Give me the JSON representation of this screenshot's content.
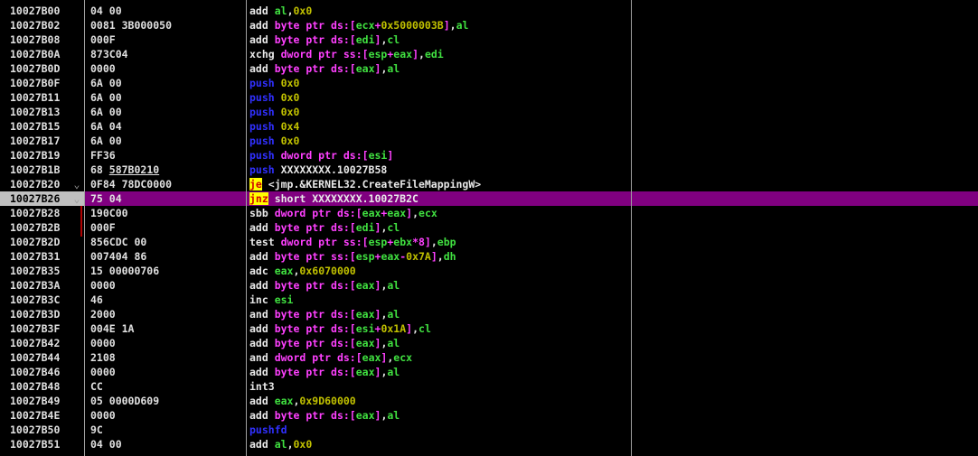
{
  "colors": {
    "background": "#000000",
    "selected_row": "#800080",
    "selected_address_bg": "#c0c0c0",
    "push_pop": "#3030ff",
    "keyword": "#ff40ff",
    "register": "#40e040",
    "immediate": "#c0c000",
    "jump_highlight_bg": "#ffff00",
    "jump_highlight_fg": "#d00000"
  },
  "rows": [
    {
      "addr": "10027B00",
      "mark": "",
      "hex": "04 00",
      "t": [
        [
          "mn",
          "add "
        ],
        [
          "gr",
          "al"
        ],
        [
          "tx",
          ","
        ],
        [
          "nu",
          "0x0"
        ]
      ]
    },
    {
      "addr": "10027B02",
      "mark": "",
      "hex": "0081 3B000050",
      "t": [
        [
          "mn",
          "add "
        ],
        [
          "kw",
          "byte ptr ds:["
        ],
        [
          "gr",
          "ecx"
        ],
        [
          "kw",
          "+"
        ],
        [
          "nu",
          "0x5000003B"
        ],
        [
          "kw",
          "]"
        ],
        [
          "tx",
          ","
        ],
        [
          "gr",
          "al"
        ]
      ]
    },
    {
      "addr": "10027B08",
      "mark": "",
      "hex": "000F",
      "t": [
        [
          "mn",
          "add "
        ],
        [
          "kw",
          "byte ptr ds:["
        ],
        [
          "gr",
          "edi"
        ],
        [
          "kw",
          "]"
        ],
        [
          "tx",
          ","
        ],
        [
          "gr",
          "cl"
        ]
      ]
    },
    {
      "addr": "10027B0A",
      "mark": "",
      "hex": "873C04",
      "t": [
        [
          "mn",
          "xchg "
        ],
        [
          "kw",
          "dword ptr ss:["
        ],
        [
          "gr",
          "esp"
        ],
        [
          "kw",
          "+"
        ],
        [
          "gr",
          "eax"
        ],
        [
          "kw",
          "]"
        ],
        [
          "tx",
          ","
        ],
        [
          "gr",
          "edi"
        ]
      ]
    },
    {
      "addr": "10027B0D",
      "mark": "",
      "hex": "0000",
      "t": [
        [
          "mn",
          "add "
        ],
        [
          "kw",
          "byte ptr ds:["
        ],
        [
          "gr",
          "eax"
        ],
        [
          "kw",
          "]"
        ],
        [
          "tx",
          ","
        ],
        [
          "gr",
          "al"
        ]
      ]
    },
    {
      "addr": "10027B0F",
      "mark": "",
      "hex": "6A 00",
      "t": [
        [
          "pu",
          "push "
        ],
        [
          "nu",
          "0x0"
        ]
      ]
    },
    {
      "addr": "10027B11",
      "mark": "",
      "hex": "6A 00",
      "t": [
        [
          "pu",
          "push "
        ],
        [
          "nu",
          "0x0"
        ]
      ]
    },
    {
      "addr": "10027B13",
      "mark": "",
      "hex": "6A 00",
      "t": [
        [
          "pu",
          "push "
        ],
        [
          "nu",
          "0x0"
        ]
      ]
    },
    {
      "addr": "10027B15",
      "mark": "",
      "hex": "6A 04",
      "t": [
        [
          "pu",
          "push "
        ],
        [
          "nu",
          "0x4"
        ]
      ]
    },
    {
      "addr": "10027B17",
      "mark": "",
      "hex": "6A 00",
      "t": [
        [
          "pu",
          "push "
        ],
        [
          "nu",
          "0x0"
        ]
      ]
    },
    {
      "addr": "10027B19",
      "mark": "",
      "hex": "FF36",
      "t": [
        [
          "pu",
          "push "
        ],
        [
          "kw",
          "dword ptr ds:["
        ],
        [
          "gr",
          "esi"
        ],
        [
          "kw",
          "]"
        ]
      ]
    },
    {
      "addr": "10027B1B",
      "mark": "",
      "hex": "68 ",
      "hexu": "587B0210",
      "t": [
        [
          "pu",
          "push "
        ],
        [
          "tx",
          "XXXXXXXX.10027B58"
        ]
      ]
    },
    {
      "addr": "10027B20",
      "mark": "⌄",
      "hex": "0F84 78DC0000",
      "t": [
        [
          "hl",
          "je"
        ],
        [
          "tx",
          " <jmp.&KERNEL32.CreateFileMappingW>"
        ]
      ]
    },
    {
      "addr": "10027B26",
      "mark": "⌄",
      "hex": "75 04",
      "sel": true,
      "t": [
        [
          "hl",
          "jnz"
        ],
        [
          "tx",
          " short XXXXXXXX.10027B2C"
        ]
      ]
    },
    {
      "addr": "10027B28",
      "mark": "",
      "hex": "190C00",
      "t": [
        [
          "mn",
          "sbb "
        ],
        [
          "kw",
          "dword ptr ds:["
        ],
        [
          "gr",
          "eax"
        ],
        [
          "kw",
          "+"
        ],
        [
          "gr",
          "eax"
        ],
        [
          "kw",
          "]"
        ],
        [
          "tx",
          ","
        ],
        [
          "gr",
          "ecx"
        ]
      ]
    },
    {
      "addr": "10027B2B",
      "mark": "",
      "hex": "000F",
      "t": [
        [
          "mn",
          "add "
        ],
        [
          "kw",
          "byte ptr ds:["
        ],
        [
          "gr",
          "edi"
        ],
        [
          "kw",
          "]"
        ],
        [
          "tx",
          ","
        ],
        [
          "gr",
          "cl"
        ]
      ]
    },
    {
      "addr": "10027B2D",
      "mark": "",
      "hex": "856CDC 00",
      "t": [
        [
          "mn",
          "test "
        ],
        [
          "kw",
          "dword ptr ss:["
        ],
        [
          "gr",
          "esp"
        ],
        [
          "kw",
          "+"
        ],
        [
          "gr",
          "ebx"
        ],
        [
          "kw",
          "*8]"
        ],
        [
          "tx",
          ","
        ],
        [
          "gr",
          "ebp"
        ]
      ]
    },
    {
      "addr": "10027B31",
      "mark": "",
      "hex": "007404 86",
      "t": [
        [
          "mn",
          "add "
        ],
        [
          "kw",
          "byte ptr ss:["
        ],
        [
          "gr",
          "esp"
        ],
        [
          "kw",
          "+"
        ],
        [
          "gr",
          "eax"
        ],
        [
          "kw",
          "-"
        ],
        [
          "nu",
          "0x7A"
        ],
        [
          "kw",
          "]"
        ],
        [
          "tx",
          ","
        ],
        [
          "gr",
          "dh"
        ]
      ]
    },
    {
      "addr": "10027B35",
      "mark": "",
      "hex": "15 00000706",
      "t": [
        [
          "mn",
          "adc "
        ],
        [
          "gr",
          "eax"
        ],
        [
          "tx",
          ","
        ],
        [
          "nu",
          "0x6070000"
        ]
      ]
    },
    {
      "addr": "10027B3A",
      "mark": "",
      "hex": "0000",
      "t": [
        [
          "mn",
          "add "
        ],
        [
          "kw",
          "byte ptr ds:["
        ],
        [
          "gr",
          "eax"
        ],
        [
          "kw",
          "]"
        ],
        [
          "tx",
          ","
        ],
        [
          "gr",
          "al"
        ]
      ]
    },
    {
      "addr": "10027B3C",
      "mark": "",
      "hex": "46",
      "t": [
        [
          "mn",
          "inc "
        ],
        [
          "gr",
          "esi"
        ]
      ]
    },
    {
      "addr": "10027B3D",
      "mark": "",
      "hex": "2000",
      "t": [
        [
          "mn",
          "and "
        ],
        [
          "kw",
          "byte ptr ds:["
        ],
        [
          "gr",
          "eax"
        ],
        [
          "kw",
          "]"
        ],
        [
          "tx",
          ","
        ],
        [
          "gr",
          "al"
        ]
      ]
    },
    {
      "addr": "10027B3F",
      "mark": "",
      "hex": "004E 1A",
      "t": [
        [
          "mn",
          "add "
        ],
        [
          "kw",
          "byte ptr ds:["
        ],
        [
          "gr",
          "esi"
        ],
        [
          "kw",
          "+"
        ],
        [
          "nu",
          "0x1A"
        ],
        [
          "kw",
          "]"
        ],
        [
          "tx",
          ","
        ],
        [
          "gr",
          "cl"
        ]
      ]
    },
    {
      "addr": "10027B42",
      "mark": "",
      "hex": "0000",
      "t": [
        [
          "mn",
          "add "
        ],
        [
          "kw",
          "byte ptr ds:["
        ],
        [
          "gr",
          "eax"
        ],
        [
          "kw",
          "]"
        ],
        [
          "tx",
          ","
        ],
        [
          "gr",
          "al"
        ]
      ]
    },
    {
      "addr": "10027B44",
      "mark": "",
      "hex": "2108",
      "t": [
        [
          "mn",
          "and "
        ],
        [
          "kw",
          "dword ptr ds:["
        ],
        [
          "gr",
          "eax"
        ],
        [
          "kw",
          "]"
        ],
        [
          "tx",
          ","
        ],
        [
          "gr",
          "ecx"
        ]
      ]
    },
    {
      "addr": "10027B46",
      "mark": "",
      "hex": "0000",
      "t": [
        [
          "mn",
          "add "
        ],
        [
          "kw",
          "byte ptr ds:["
        ],
        [
          "gr",
          "eax"
        ],
        [
          "kw",
          "]"
        ],
        [
          "tx",
          ","
        ],
        [
          "gr",
          "al"
        ]
      ]
    },
    {
      "addr": "10027B48",
      "mark": "",
      "hex": "CC",
      "t": [
        [
          "mn",
          "int3"
        ]
      ]
    },
    {
      "addr": "10027B49",
      "mark": "",
      "hex": "05 0000D609",
      "t": [
        [
          "mn",
          "add "
        ],
        [
          "gr",
          "eax"
        ],
        [
          "tx",
          ","
        ],
        [
          "nu",
          "0x9D60000"
        ]
      ]
    },
    {
      "addr": "10027B4E",
      "mark": "",
      "hex": "0000",
      "t": [
        [
          "mn",
          "add "
        ],
        [
          "kw",
          "byte ptr ds:["
        ],
        [
          "gr",
          "eax"
        ],
        [
          "kw",
          "]"
        ],
        [
          "tx",
          ","
        ],
        [
          "gr",
          "al"
        ]
      ]
    },
    {
      "addr": "10027B50",
      "mark": "",
      "hex": "9C",
      "t": [
        [
          "pu",
          "pushfd"
        ]
      ]
    },
    {
      "addr": "10027B51",
      "mark": "",
      "hex": "04 00",
      "t": [
        [
          "mn",
          "add "
        ],
        [
          "gr",
          "al"
        ],
        [
          "tx",
          ","
        ],
        [
          "nu",
          "0x0"
        ]
      ]
    }
  ]
}
